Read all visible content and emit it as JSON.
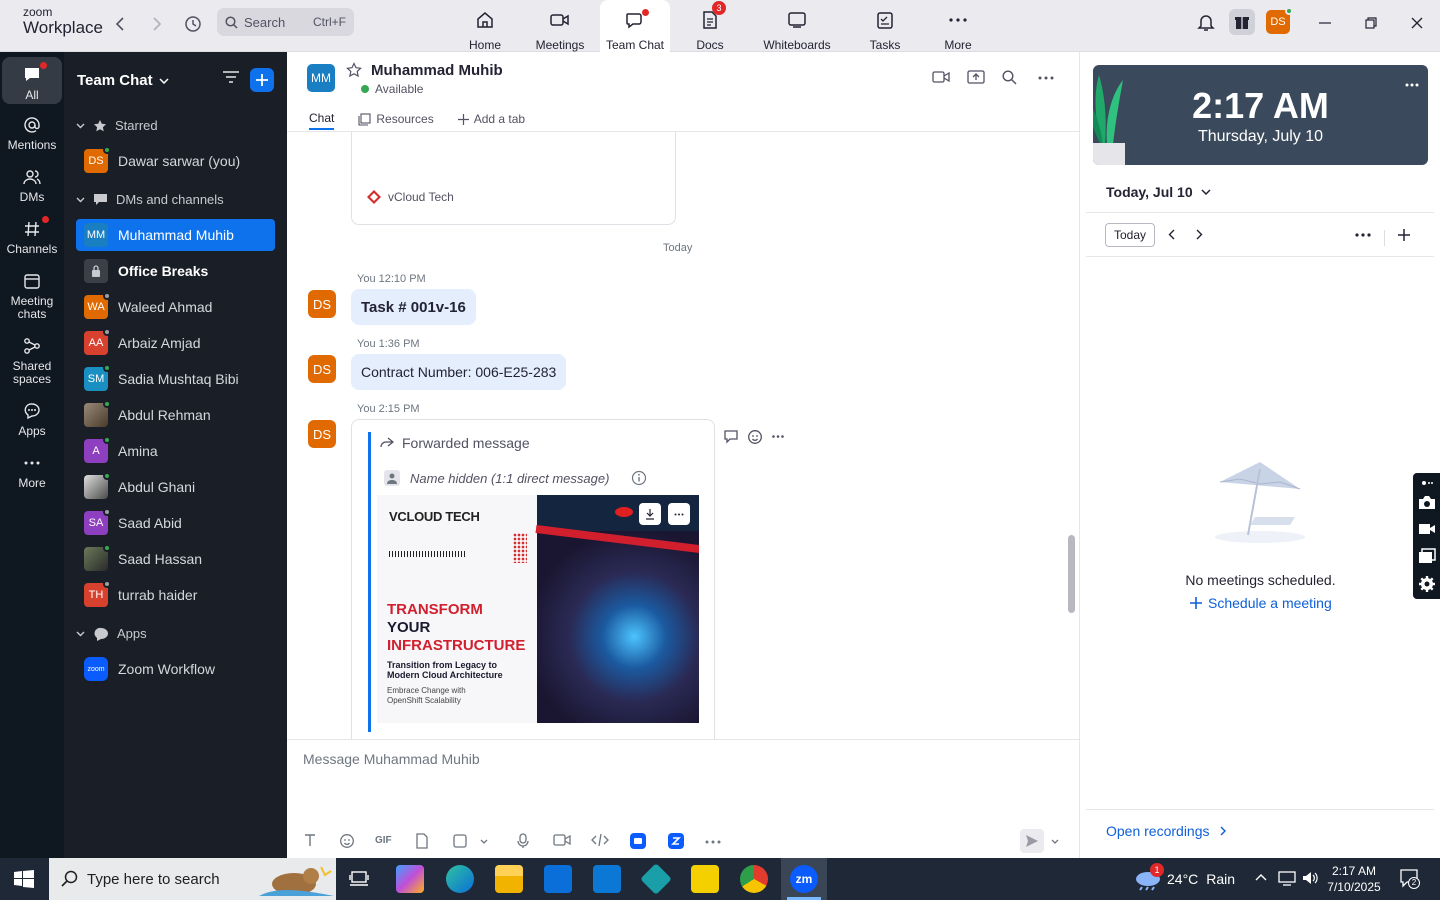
{
  "app": {
    "logo_line1": "zoom",
    "logo_line2": "Workplace"
  },
  "search": {
    "placeholder": "Search",
    "shortcut": "Ctrl+F"
  },
  "top_tabs": [
    {
      "label": "Home",
      "icon": "home-icon"
    },
    {
      "label": "Meetings",
      "icon": "video-camera-icon"
    },
    {
      "label": "Team Chat",
      "icon": "chat-bubble-icon",
      "active": true
    },
    {
      "label": "Docs",
      "icon": "document-icon",
      "badge": "3"
    },
    {
      "label": "Whiteboards",
      "icon": "whiteboard-icon"
    },
    {
      "label": "Tasks",
      "icon": "tasks-icon"
    },
    {
      "label": "More",
      "icon": "more-dots-icon"
    }
  ],
  "profile": {
    "initials": "DS",
    "color": "#e06a00"
  },
  "rail": [
    {
      "label": "All",
      "icon": "chat-bubble-icon",
      "active": true
    },
    {
      "label": "Mentions",
      "icon": "at-icon"
    },
    {
      "label": "DMs",
      "icon": "people-icon"
    },
    {
      "label": "Channels",
      "icon": "hashtag-icon"
    },
    {
      "label": "Meeting chats",
      "icon": "calendar-icon"
    },
    {
      "label": "Shared spaces",
      "icon": "share-icon"
    },
    {
      "label": "Apps",
      "icon": "apps-bubble-icon"
    },
    {
      "label": "More",
      "icon": "more-dots-icon"
    }
  ],
  "sidebar": {
    "title": "Team Chat",
    "starred_header": "Starred",
    "starred": [
      {
        "name": "Dawar sarwar (you)",
        "initials": "DS",
        "color": "#e06a00",
        "presence": "#34a853"
      }
    ],
    "dms_header": "DMs and channels",
    "dms": [
      {
        "name": "Muhammad Muhib",
        "initials": "MM",
        "color": "#1a7ec2",
        "active": true
      },
      {
        "name": "Office Breaks",
        "initials": "",
        "color": "#3b4048",
        "lock": true,
        "bold": true
      },
      {
        "name": "Waleed Ahmad",
        "initials": "WA",
        "color": "#e06a00",
        "presence": "#9aa0a6"
      },
      {
        "name": "Arbaiz Amjad",
        "initials": "AA",
        "color": "#d9412f",
        "presence": "#9aa0a6"
      },
      {
        "name": "Sadia Mushtaq Bibi",
        "initials": "SM",
        "color": "#1a8fc2",
        "presence": "#34a853"
      },
      {
        "name": "Abdul Rehman",
        "initials": "",
        "color": "#7a6a5a",
        "presence": "#34a853"
      },
      {
        "name": "Amina",
        "initials": "A",
        "color": "#8e3fbf",
        "presence": "#34a853"
      },
      {
        "name": "Abdul Ghani",
        "initials": "",
        "color": "#9a9a9a",
        "presence": "#34a853"
      },
      {
        "name": "Saad Abid",
        "initials": "SA",
        "color": "#8e3fbf",
        "presence": "#9aa0a6"
      },
      {
        "name": "Saad Hassan",
        "initials": "",
        "color": "#5a6a4a",
        "presence": "#34a853"
      },
      {
        "name": "turrab haider",
        "initials": "TH",
        "color": "#d9412f",
        "presence": "#9aa0a6"
      }
    ],
    "apps_header": "Apps",
    "apps": [
      {
        "name": "Zoom Workflow",
        "initials": "zoom",
        "color": "#0b5cff"
      }
    ]
  },
  "chat": {
    "contact": "Muhammad Muhib",
    "contact_initials": "MM",
    "status": "Available",
    "tabs": [
      "Chat",
      "Resources",
      "Add a tab"
    ],
    "prev_card_source": "vCloud Tech",
    "date_divider": "Today",
    "messages": [
      {
        "author": "You",
        "time": "12:10 PM",
        "text": "Task # 001v-16",
        "bold": true
      },
      {
        "author": "You",
        "time": "1:36 PM",
        "text": "Contract Number: 006-E25-283"
      },
      {
        "author": "You",
        "time": "2:15 PM",
        "forwarded_label": "Forwarded message",
        "name_hidden": "Name hidden (1:1 direct message)"
      }
    ],
    "avatar_initials": "DS",
    "image_card": {
      "brand": "VCLOUD TECH",
      "headline1": "TRANSFORM",
      "headline2": "YOUR",
      "headline3": "INFRASTRUCTURE",
      "sub1": "Transition from Legacy to",
      "sub2": "Modern Cloud Architecture",
      "sub3": "Embrace Change with",
      "sub4": "OpenShift Scalability"
    },
    "composer_placeholder": "Message Muhammad Muhib"
  },
  "right_panel": {
    "time": "2:17 AM",
    "date": "Thursday, July 10",
    "day_selector": "Today, Jul 10",
    "today_button": "Today",
    "empty_text": "No meetings scheduled.",
    "schedule_link": "Schedule a meeting",
    "recordings_link": "Open recordings"
  },
  "taskbar": {
    "search_placeholder": "Type here to search",
    "weather_temp": "24°C",
    "weather_text": "Rain",
    "weather_badge": "1",
    "clock_time": "2:17 AM",
    "clock_date": "7/10/2025",
    "notif_count": "2"
  }
}
